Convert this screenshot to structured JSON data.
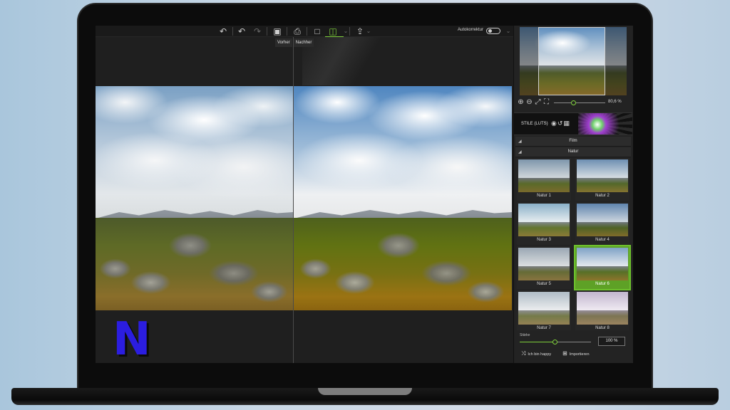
{
  "toolbar": {
    "auto_correct_label": "Autokorrektur",
    "icons": [
      "undo-icon",
      "undo-step-icon",
      "redo-icon",
      "save-icon",
      "print-icon",
      "single-view-icon",
      "split-view-icon",
      "export-icon"
    ]
  },
  "compare": {
    "before_label": "Vorher",
    "after_label": "Nachher"
  },
  "navigator": {
    "zoom_value": "80,6 %"
  },
  "luts": {
    "title": "STILE (LUTS)"
  },
  "sections": {
    "film": "Film",
    "nature": "Natur"
  },
  "thumbnails": [
    {
      "label": "Natur 1",
      "selected": false
    },
    {
      "label": "Natur 2",
      "selected": false
    },
    {
      "label": "Natur 3",
      "selected": false
    },
    {
      "label": "Natur 4",
      "selected": false
    },
    {
      "label": "Natur 5",
      "selected": false
    },
    {
      "label": "Natur 6",
      "selected": true
    },
    {
      "label": "Natur 7",
      "selected": false
    },
    {
      "label": "Natur 8",
      "selected": false
    }
  ],
  "strength": {
    "label": "Stärke",
    "value": "100 %",
    "fraction": 0.5
  },
  "actions": {
    "happy": "Ich bin happy",
    "import": "Importieren"
  },
  "branding": {
    "logo_letter": "N",
    "logo_color": "#2b1de0"
  },
  "colors": {
    "accent": "#7fd13b",
    "panel_bg": "#232323"
  }
}
